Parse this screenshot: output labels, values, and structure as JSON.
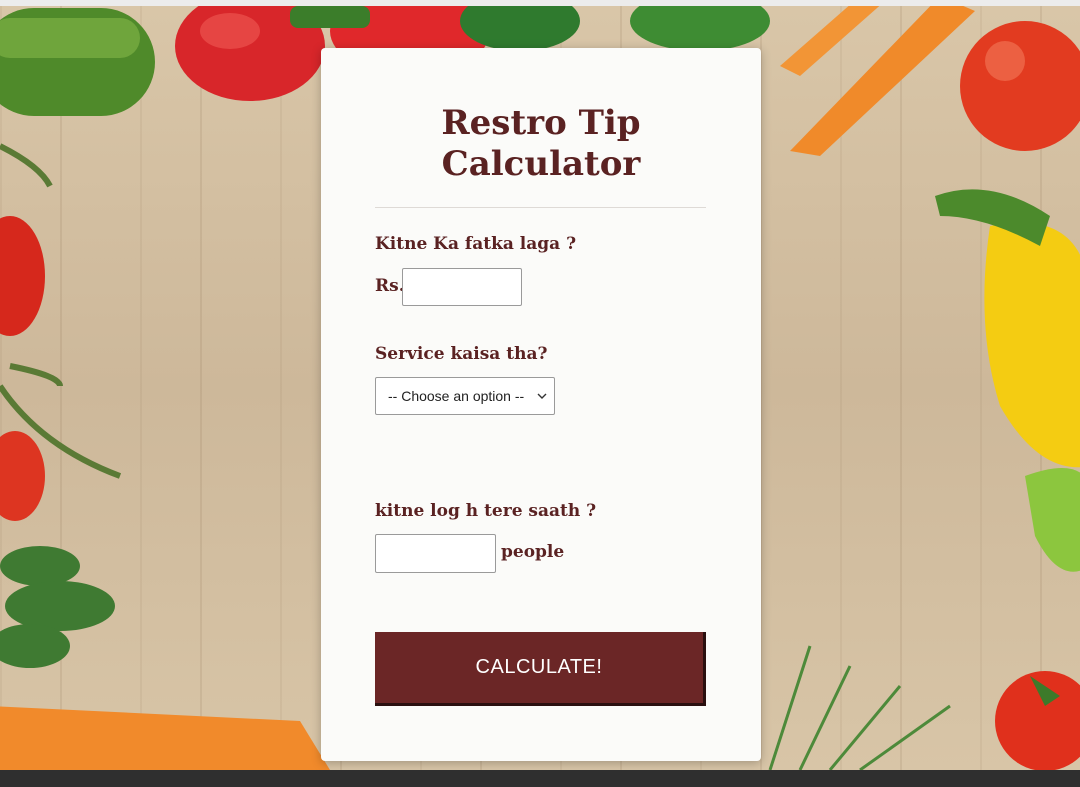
{
  "app": {
    "title_line1": "Restro Tip",
    "title_line2": "Calculator"
  },
  "bill": {
    "label": "Kitne Ka fatka laga ?",
    "currency_prefix": "Rs.",
    "value": "",
    "placeholder": ""
  },
  "service": {
    "label": "Service kaisa tha?",
    "selected_option": "-- Choose an option --"
  },
  "people": {
    "label": "kitne log h tere saath ?",
    "value": "",
    "placeholder": "",
    "suffix": "people"
  },
  "actions": {
    "calculate_label": "CALCULATE!"
  },
  "colors": {
    "accent": "#6b2626",
    "text": "#5a2222",
    "card": "#fbfbf9"
  },
  "icons": {
    "select_arrow": "chevron-down-icon"
  }
}
